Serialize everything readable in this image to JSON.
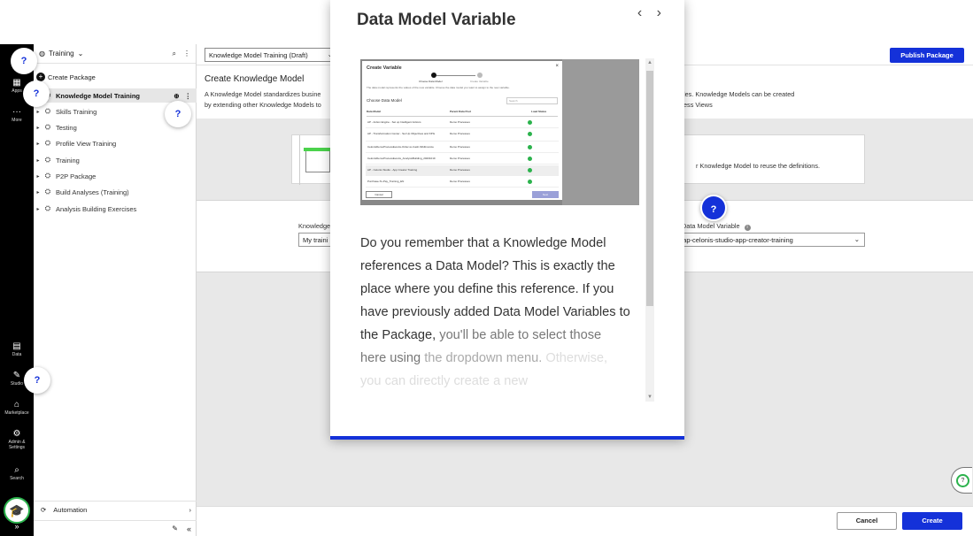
{
  "rail": {
    "items": [
      {
        "label": "Apps",
        "icon": "apps-grid-icon"
      },
      {
        "label": "More",
        "icon": "more-dots-icon"
      },
      {
        "label": "Data",
        "icon": "data-icon"
      },
      {
        "label": "Studio",
        "icon": "studio-icon"
      },
      {
        "label": "Marketplace",
        "icon": "marketplace-icon"
      },
      {
        "label": "Admin & Settings",
        "icon": "admin-settings-icon"
      },
      {
        "label": "Search",
        "icon": "search-icon"
      }
    ]
  },
  "sidebar": {
    "space_name": "Training",
    "create_package": "Create Package",
    "tree": [
      {
        "label": "Knowledge Model Training",
        "selected": true
      },
      {
        "label": "Skills Training"
      },
      {
        "label": "Testing"
      },
      {
        "label": "Profile View Training"
      },
      {
        "label": "Training"
      },
      {
        "label": "P2P Package"
      },
      {
        "label": "Build Analyses (Training)"
      },
      {
        "label": "Analysis Building Exercises"
      }
    ],
    "footer": "Automation"
  },
  "main": {
    "version_select": "Knowledge Model Training (Draft)",
    "publish_label": "Publish Package",
    "title": "Create Knowledge Model",
    "desc_line1_left": "A Knowledge Model standardizes busine",
    "desc_line1_right": "les. Knowledge Models can be created",
    "desc_line2_left": "by extending other Knowledge Models to",
    "desc_line2_right": "ess Views",
    "card_text": "r Knowledge Model to reuse the definitions.",
    "km_label": "Knowledge",
    "km_value": "My traini",
    "dmv_label": "Data Model Variable",
    "dmv_value": "dap-celonis-studio-app-creator-training",
    "cancel_label": "Cancel",
    "create_label": "Create"
  },
  "help_mark": "?",
  "modal": {
    "title": "Data Model Variable",
    "prev": "‹",
    "next": "›",
    "screenshot": {
      "title": "Create Variable",
      "step1": "Choose Data Model",
      "step2": "Create Variable",
      "description": "The data model represents the values of the new variable. Choose the data model you want to assign to the new variable.",
      "heading": "Choose Data Model",
      "search_placeholder": "Search",
      "col1": "Data Model",
      "col2": "Parent Data Pool",
      "col3": "Load Status",
      "rows": [
        {
          "model": "AP - Action Engine - Set up Intelligent Actions",
          "pool": "Demo Processes"
        },
        {
          "model": "AP - Transformation Center - Set Up Objectives and KPIs",
          "pool": "Demo Processes"
        },
        {
          "model": "CelonisDemoProcessEvents-Order-to-Cash-SD&Invoice",
          "pool": "Demo Processes"
        },
        {
          "model": "CelonisDemoProcessEvents_AnalysisBuilding_20201019",
          "pool": "Demo Processes"
        },
        {
          "model": "AP - Celonis Studio - App Creator Training",
          "pool": "Demo Processes"
        },
        {
          "model": "Purchase-To-Pay_Training_EN",
          "pool": "Demo Processes"
        }
      ],
      "cancel": "Cancel",
      "next": "Next"
    },
    "body": "Do you remember that a Knowledge Model references a Data Model? This is exactly the place where you define this reference. If you have previously added Data Model Variables to the Package,",
    "body_fade1": "you'll be able to select those here using",
    "body_fade2": "the dropdown menu.",
    "body_fade3": "Otherwise, you can directly create a new"
  }
}
